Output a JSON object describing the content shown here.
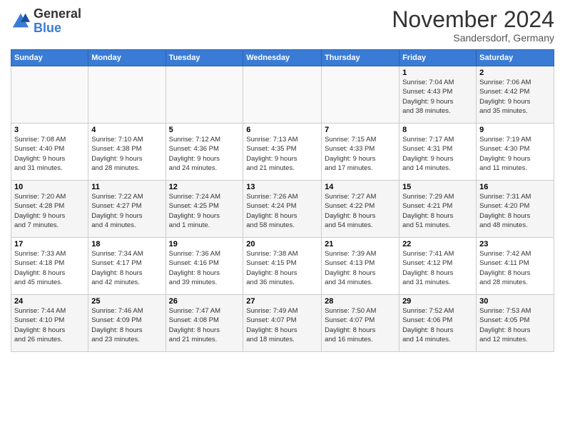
{
  "logo": {
    "general": "General",
    "blue": "Blue"
  },
  "header": {
    "month": "November 2024",
    "location": "Sandersdorf, Germany"
  },
  "weekdays": [
    "Sunday",
    "Monday",
    "Tuesday",
    "Wednesday",
    "Thursday",
    "Friday",
    "Saturday"
  ],
  "weeks": [
    [
      {
        "day": "",
        "info": ""
      },
      {
        "day": "",
        "info": ""
      },
      {
        "day": "",
        "info": ""
      },
      {
        "day": "",
        "info": ""
      },
      {
        "day": "",
        "info": ""
      },
      {
        "day": "1",
        "info": "Sunrise: 7:04 AM\nSunset: 4:43 PM\nDaylight: 9 hours\nand 38 minutes."
      },
      {
        "day": "2",
        "info": "Sunrise: 7:06 AM\nSunset: 4:42 PM\nDaylight: 9 hours\nand 35 minutes."
      }
    ],
    [
      {
        "day": "3",
        "info": "Sunrise: 7:08 AM\nSunset: 4:40 PM\nDaylight: 9 hours\nand 31 minutes."
      },
      {
        "day": "4",
        "info": "Sunrise: 7:10 AM\nSunset: 4:38 PM\nDaylight: 9 hours\nand 28 minutes."
      },
      {
        "day": "5",
        "info": "Sunrise: 7:12 AM\nSunset: 4:36 PM\nDaylight: 9 hours\nand 24 minutes."
      },
      {
        "day": "6",
        "info": "Sunrise: 7:13 AM\nSunset: 4:35 PM\nDaylight: 9 hours\nand 21 minutes."
      },
      {
        "day": "7",
        "info": "Sunrise: 7:15 AM\nSunset: 4:33 PM\nDaylight: 9 hours\nand 17 minutes."
      },
      {
        "day": "8",
        "info": "Sunrise: 7:17 AM\nSunset: 4:31 PM\nDaylight: 9 hours\nand 14 minutes."
      },
      {
        "day": "9",
        "info": "Sunrise: 7:19 AM\nSunset: 4:30 PM\nDaylight: 9 hours\nand 11 minutes."
      }
    ],
    [
      {
        "day": "10",
        "info": "Sunrise: 7:20 AM\nSunset: 4:28 PM\nDaylight: 9 hours\nand 7 minutes."
      },
      {
        "day": "11",
        "info": "Sunrise: 7:22 AM\nSunset: 4:27 PM\nDaylight: 9 hours\nand 4 minutes."
      },
      {
        "day": "12",
        "info": "Sunrise: 7:24 AM\nSunset: 4:25 PM\nDaylight: 9 hours\nand 1 minute."
      },
      {
        "day": "13",
        "info": "Sunrise: 7:26 AM\nSunset: 4:24 PM\nDaylight: 8 hours\nand 58 minutes."
      },
      {
        "day": "14",
        "info": "Sunrise: 7:27 AM\nSunset: 4:22 PM\nDaylight: 8 hours\nand 54 minutes."
      },
      {
        "day": "15",
        "info": "Sunrise: 7:29 AM\nSunset: 4:21 PM\nDaylight: 8 hours\nand 51 minutes."
      },
      {
        "day": "16",
        "info": "Sunrise: 7:31 AM\nSunset: 4:20 PM\nDaylight: 8 hours\nand 48 minutes."
      }
    ],
    [
      {
        "day": "17",
        "info": "Sunrise: 7:33 AM\nSunset: 4:18 PM\nDaylight: 8 hours\nand 45 minutes."
      },
      {
        "day": "18",
        "info": "Sunrise: 7:34 AM\nSunset: 4:17 PM\nDaylight: 8 hours\nand 42 minutes."
      },
      {
        "day": "19",
        "info": "Sunrise: 7:36 AM\nSunset: 4:16 PM\nDaylight: 8 hours\nand 39 minutes."
      },
      {
        "day": "20",
        "info": "Sunrise: 7:38 AM\nSunset: 4:15 PM\nDaylight: 8 hours\nand 36 minutes."
      },
      {
        "day": "21",
        "info": "Sunrise: 7:39 AM\nSunset: 4:13 PM\nDaylight: 8 hours\nand 34 minutes."
      },
      {
        "day": "22",
        "info": "Sunrise: 7:41 AM\nSunset: 4:12 PM\nDaylight: 8 hours\nand 31 minutes."
      },
      {
        "day": "23",
        "info": "Sunrise: 7:42 AM\nSunset: 4:11 PM\nDaylight: 8 hours\nand 28 minutes."
      }
    ],
    [
      {
        "day": "24",
        "info": "Sunrise: 7:44 AM\nSunset: 4:10 PM\nDaylight: 8 hours\nand 26 minutes."
      },
      {
        "day": "25",
        "info": "Sunrise: 7:46 AM\nSunset: 4:09 PM\nDaylight: 8 hours\nand 23 minutes."
      },
      {
        "day": "26",
        "info": "Sunrise: 7:47 AM\nSunset: 4:08 PM\nDaylight: 8 hours\nand 21 minutes."
      },
      {
        "day": "27",
        "info": "Sunrise: 7:49 AM\nSunset: 4:07 PM\nDaylight: 8 hours\nand 18 minutes."
      },
      {
        "day": "28",
        "info": "Sunrise: 7:50 AM\nSunset: 4:07 PM\nDaylight: 8 hours\nand 16 minutes."
      },
      {
        "day": "29",
        "info": "Sunrise: 7:52 AM\nSunset: 4:06 PM\nDaylight: 8 hours\nand 14 minutes."
      },
      {
        "day": "30",
        "info": "Sunrise: 7:53 AM\nSunset: 4:05 PM\nDaylight: 8 hours\nand 12 minutes."
      }
    ]
  ]
}
